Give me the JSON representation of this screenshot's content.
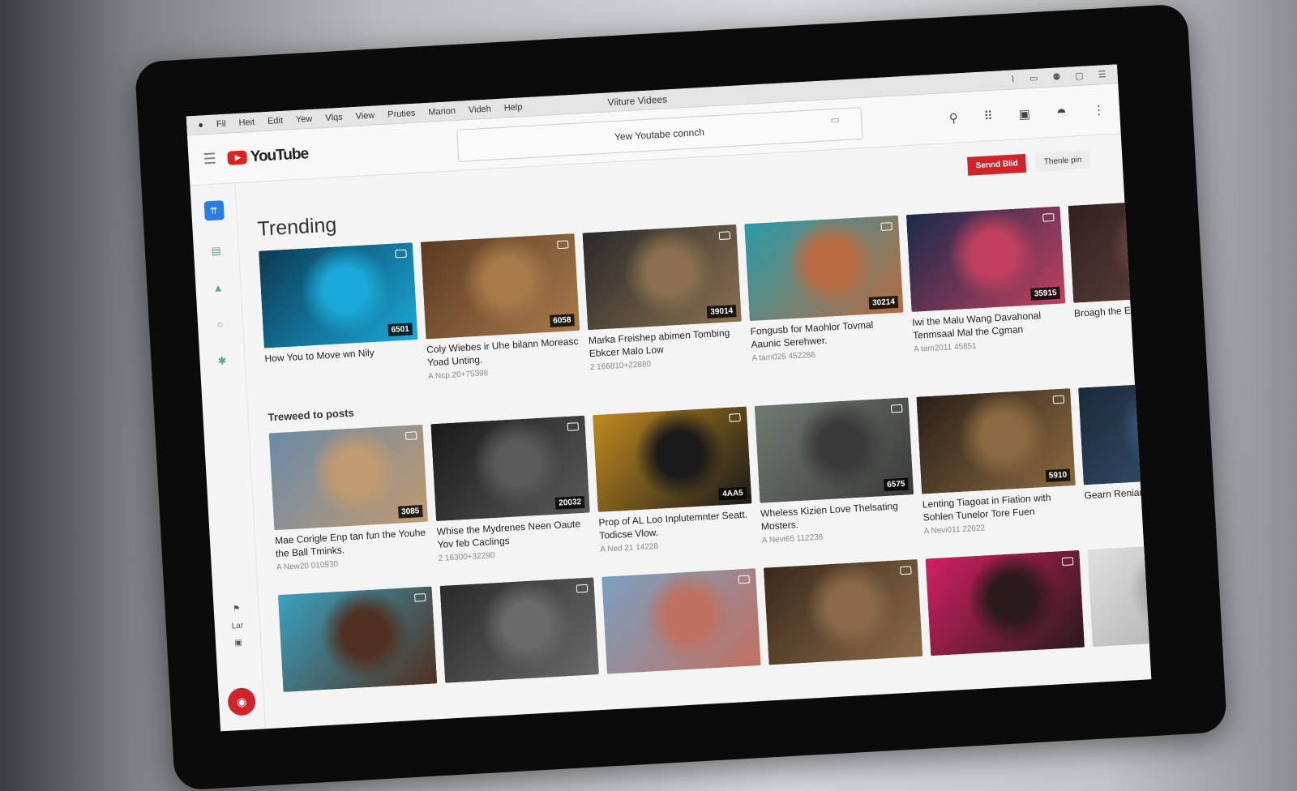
{
  "window": {
    "title": "Viiture Videes",
    "menu": [
      "Fil",
      "Heit",
      "Edit",
      "Yew",
      "Vlqs",
      "View",
      "Pruties",
      "Marion",
      "Videh",
      "Help"
    ]
  },
  "topbar": {
    "logo": "YouTube",
    "search_value": "Yew Youtabe connch"
  },
  "buttons": {
    "primary": "Sennd Blid",
    "secondary": "Thenle pin"
  },
  "sidebar": {
    "bottom_label": "Lar"
  },
  "sections": [
    {
      "title": "Trending",
      "videos": [
        {
          "title": "How You to Move wn Nily",
          "meta": "",
          "duration": "6501",
          "colors": [
            "#0d3a55",
            "#1aa8d8"
          ]
        },
        {
          "title": "Coly Wiebes ir Uhe bilann Moreasc Yoad Unting.",
          "meta": "A Ncp.20+75398",
          "duration": "6058",
          "colors": [
            "#5a3a22",
            "#a87a4a"
          ]
        },
        {
          "title": "Marka Freishep abimen Tombing Ebkcer Malo Low",
          "meta": "2 166810+22880",
          "duration": "39014",
          "colors": [
            "#2a2a2a",
            "#8a7050"
          ]
        },
        {
          "title": "Fongusb for Maohlor Tovmal Aaunic Serehwer.",
          "meta": "A tam026 452286",
          "duration": "30214",
          "colors": [
            "#2a9aa8",
            "#b86a40"
          ]
        },
        {
          "title": "Iwi the Malu Wang Davahonal Tenmsaal Mal the Cgman",
          "meta": "A tam2011 45851",
          "duration": "35915",
          "colors": [
            "#1a2a4a",
            "#c04060"
          ]
        },
        {
          "title": "Broagh the Elig",
          "meta": "",
          "duration": "",
          "colors": [
            "#302020",
            "#6a4a40"
          ]
        }
      ]
    },
    {
      "title": "Treweed to posts",
      "videos": [
        {
          "title": "Mae Corigle Enp tan fun the Youhe the Ball Tminks.",
          "meta": "A New20 010930",
          "duration": "3085",
          "colors": [
            "#6a8aa8",
            "#c09a70"
          ]
        },
        {
          "title": "Whise the Mydrenes Neen Oaute Yov feb Caclings",
          "meta": "2 16300+32290",
          "duration": "20032",
          "colors": [
            "#1a1a1a",
            "#5a5a5a"
          ]
        },
        {
          "title": "Prop of AL Loo Inplutemnter Seatt. Todicse Vlow.",
          "meta": "A Ned 21 14228",
          "duration": "4AA5",
          "colors": [
            "#c08a20",
            "#1a1a1a"
          ]
        },
        {
          "title": "Wheless Kizien Love Thelsating Mosters.",
          "meta": "A Nevi65 112236",
          "duration": "6575",
          "colors": [
            "#707a70",
            "#3a3a3a"
          ]
        },
        {
          "title": "Lenting Tiagoat in Fiation with Sohlen Tunelor Tore Fuen",
          "meta": "A Nevi011 22622",
          "duration": "5910",
          "colors": [
            "#2a2018",
            "#8a6a40"
          ]
        },
        {
          "title": "Gearn Reniar",
          "meta": "",
          "duration": "",
          "colors": [
            "#1a2a3a",
            "#3a5a7a"
          ]
        }
      ]
    },
    {
      "title": "",
      "videos": [
        {
          "title": "",
          "meta": "",
          "duration": "",
          "colors": [
            "#3aa0c0",
            "#503020"
          ]
        },
        {
          "title": "",
          "meta": "",
          "duration": "",
          "colors": [
            "#2a2a2a",
            "#6a6a6a"
          ]
        },
        {
          "title": "",
          "meta": "",
          "duration": "",
          "colors": [
            "#7aa0c0",
            "#c07060"
          ]
        },
        {
          "title": "",
          "meta": "",
          "duration": "",
          "colors": [
            "#3a2a1a",
            "#8a6a4a"
          ]
        },
        {
          "title": "",
          "meta": "",
          "duration": "",
          "colors": [
            "#d02060",
            "#2a1a1a"
          ]
        },
        {
          "title": "",
          "meta": "",
          "duration": "",
          "colors": [
            "#e0e0e0",
            "#a0a0a0"
          ]
        }
      ]
    }
  ]
}
